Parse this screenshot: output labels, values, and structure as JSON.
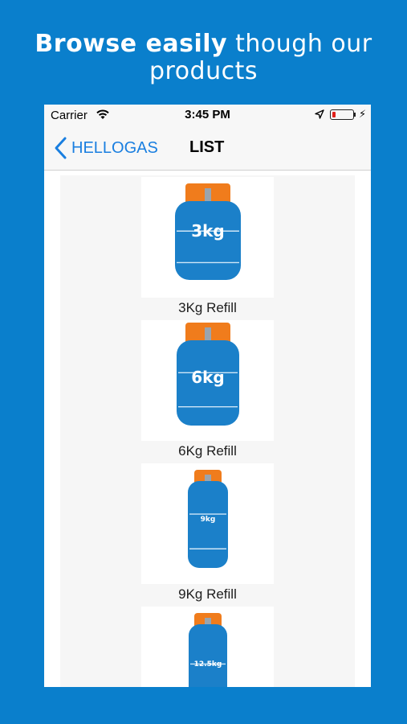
{
  "headline": {
    "bold": "Browse easily",
    "light": " though our",
    "line2": "products"
  },
  "status": {
    "carrier": "Carrier",
    "time": "3:45 PM",
    "battery_level_percent": 10
  },
  "nav": {
    "back_label": "HELLOGAS",
    "title": "LIST"
  },
  "colors": {
    "background": "#0a7fcc",
    "cylinder": "#1b80c9",
    "valve": "#f07c1c",
    "accent": "#1a7fe0"
  },
  "products": [
    {
      "label": "3kg",
      "caption": "3Kg Refill"
    },
    {
      "label": "6kg",
      "caption": "6Kg Refill"
    },
    {
      "label": "9kg",
      "caption": "9Kg Refill"
    },
    {
      "label": "12.5kg",
      "caption": ""
    }
  ]
}
